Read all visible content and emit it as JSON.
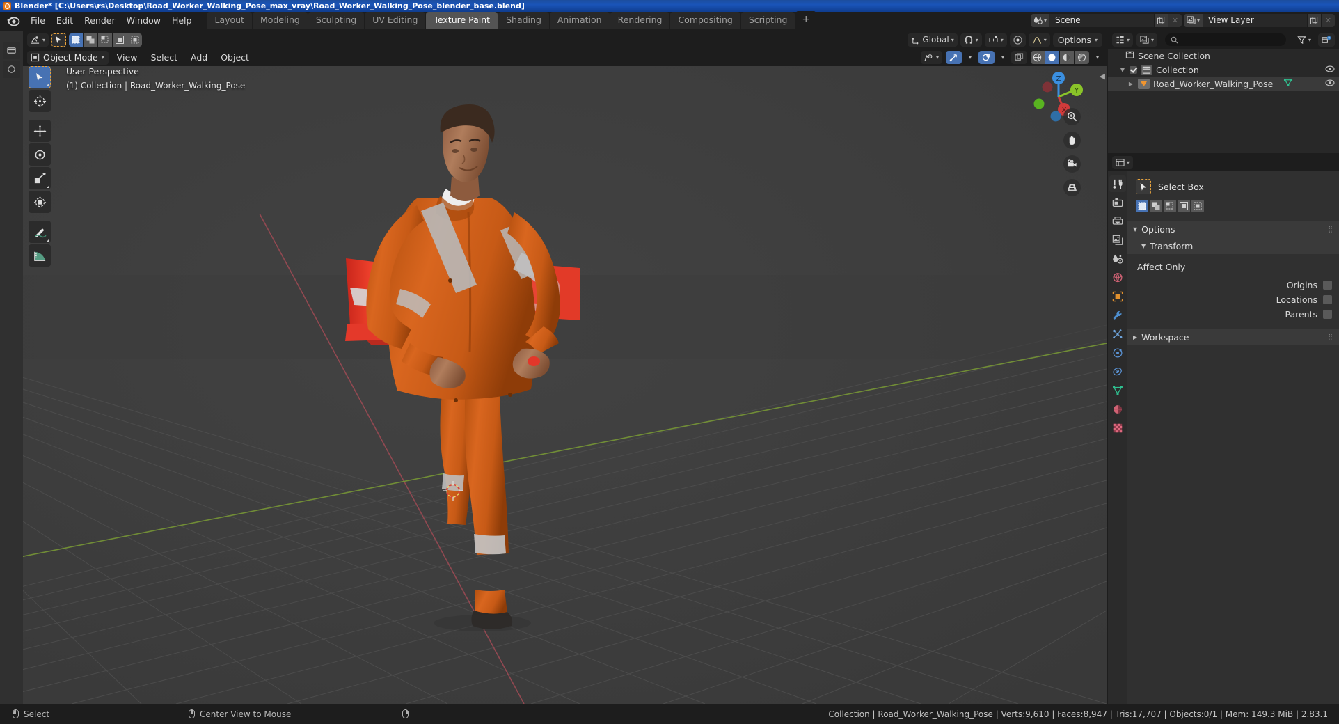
{
  "window": {
    "title": "Blender* [C:\\Users\\rs\\Desktop\\Road_Worker_Walking_Pose_max_vray\\Road_Worker_Walking_Pose_blender_base.blend]",
    "app_icon": "blender-icon"
  },
  "menubar": {
    "items": [
      "File",
      "Edit",
      "Render",
      "Window",
      "Help"
    ]
  },
  "workspace_tabs": {
    "tabs": [
      "Layout",
      "Modeling",
      "Sculpting",
      "UV Editing",
      "Texture Paint",
      "Shading",
      "Animation",
      "Rendering",
      "Compositing",
      "Scripting"
    ],
    "active": "Texture Paint",
    "add_label": "+"
  },
  "topbar_right": {
    "scene": {
      "icon": "scene-icon",
      "name": "Scene",
      "new_label": "new-copy-icon",
      "unlink_label": "x-icon"
    },
    "view_layer": {
      "icon": "view-layer-icon",
      "name": "View Layer",
      "new_label": "new-copy-icon",
      "unlink_label": "x-icon"
    }
  },
  "viewport_header": {
    "editor_type_icon": "editor-type-icon",
    "cursor_icon": "cursor-select-icon",
    "select_modes": [
      "set",
      "extend",
      "subtract",
      "invert",
      "intersect"
    ],
    "select_mode_active": "set",
    "transform_orientation": "Global",
    "snap_icon": "magnet-icon",
    "snap_target_icon": "snap-increment-icon",
    "proportional_icon": "proportional-edit-icon",
    "falloff_icon": "smooth-falloff-icon",
    "options_label": "Options",
    "mode": "Object Mode",
    "menus": [
      "View",
      "Select",
      "Add",
      "Object"
    ],
    "right_icons": [
      "visibility-icon",
      "gizmo-icon",
      "overlays-icon",
      "xray-icon"
    ],
    "shading_modes": [
      "wireframe",
      "solid",
      "material-preview",
      "rendered"
    ],
    "shading_active": "solid"
  },
  "viewport": {
    "overlay_line1": "User Perspective",
    "overlay_line2": "(1) Collection | Road_Worker_Walking_Pose",
    "gizmo_axes": [
      {
        "label": "Z",
        "color": "#3b8fe0"
      },
      {
        "label": "Y",
        "color": "#8ac429"
      },
      {
        "label": "X",
        "color": "#e04b4b"
      }
    ],
    "nav_buttons": [
      "zoom-icon",
      "pan-hand-icon",
      "camera-icon",
      "ortho-persp-icon"
    ],
    "grid_color": "#4b4b4b",
    "background_color": "#3b3b3b",
    "x_axis_color": "#9b4a53",
    "y_axis_color": "#7a9b35"
  },
  "toolbar_tools": [
    {
      "name": "tweak-select-box-tool",
      "active": true
    },
    {
      "name": "cursor-tool",
      "active": false
    },
    {
      "name": "move-tool",
      "active": false
    },
    {
      "name": "rotate-tool",
      "active": false
    },
    {
      "name": "scale-tool",
      "active": false
    },
    {
      "name": "transform-tool",
      "active": false
    },
    {
      "name": "annotate-tool",
      "active": false
    },
    {
      "name": "measure-tool",
      "active": false
    }
  ],
  "outliner": {
    "header_icons": [
      "outliner-display-mode-icon",
      "view-layer-filter-icon",
      "search-icon",
      "filter-icon",
      "new-collection-icon"
    ],
    "search_placeholder": "",
    "rows": [
      {
        "label": "Scene Collection",
        "icon": "collection-icon",
        "indent": 0,
        "has_disclosure": false,
        "has_checkbox": false,
        "has_eye": false,
        "selected": false
      },
      {
        "label": "Collection",
        "icon": "collection-icon",
        "indent": 1,
        "has_disclosure": true,
        "has_checkbox": true,
        "has_eye": true,
        "selected": false
      },
      {
        "label": "Road_Worker_Walking_Pose",
        "icon": "mesh-object-icon",
        "indent": 2,
        "has_disclosure": true,
        "has_checkbox": false,
        "has_eye": true,
        "selected": true,
        "data_icon": "mesh-data-icon"
      }
    ]
  },
  "properties": {
    "header_icon": "properties-editor-icon",
    "tabs": [
      {
        "name": "tool-tab",
        "icon": "tool-icon",
        "active": true
      },
      {
        "name": "render-tab",
        "icon": "camera-back-icon",
        "active": false
      },
      {
        "name": "output-tab",
        "icon": "printer-icon",
        "active": false
      },
      {
        "name": "view-layer-tab",
        "icon": "images-icon",
        "active": false
      },
      {
        "name": "scene-tab",
        "icon": "scene-cone-icon",
        "active": false
      },
      {
        "name": "world-tab",
        "icon": "world-icon",
        "active": false
      },
      {
        "name": "object-tab",
        "icon": "object-square-icon",
        "active": false
      },
      {
        "name": "modifiers-tab",
        "icon": "wrench-icon",
        "active": false
      },
      {
        "name": "particles-tab",
        "icon": "particles-icon",
        "active": false
      },
      {
        "name": "physics-tab",
        "icon": "physics-orbit-icon",
        "active": false
      },
      {
        "name": "constraints-tab",
        "icon": "constraint-icon",
        "active": false
      },
      {
        "name": "data-tab",
        "icon": "mesh-data-green-icon",
        "active": false
      },
      {
        "name": "material-tab",
        "icon": "material-sphere-icon",
        "active": false
      },
      {
        "name": "texture-tab",
        "icon": "texture-checker-icon",
        "active": false
      }
    ],
    "active_tool": {
      "icon": "select-box-icon",
      "name": "Select Box",
      "modes": [
        "set",
        "extend",
        "subtract",
        "invert",
        "intersect"
      ],
      "mode_active": "set"
    },
    "panels": [
      {
        "title": "Options",
        "expanded": true,
        "subpanel": {
          "title": "Transform",
          "expanded": true
        },
        "section_label": "Affect Only",
        "rows": [
          {
            "label": "Origins",
            "checked": false
          },
          {
            "label": "Locations",
            "checked": false
          },
          {
            "label": "Parents",
            "checked": false
          }
        ]
      },
      {
        "title": "Workspace",
        "expanded": false
      }
    ]
  },
  "statusbar": {
    "items": [
      {
        "mouse": "left",
        "label": "Select"
      },
      {
        "mouse": "middle",
        "label": "Center View to Mouse"
      },
      {
        "mouse": "right",
        "label": ""
      }
    ],
    "stats": "Collection | Road_Worker_Walking_Pose | Verts:9,610 | Faces:8,947 | Tris:17,707 | Objects:0/1 | Mem: 149.3 MiB | 2.83.1"
  }
}
